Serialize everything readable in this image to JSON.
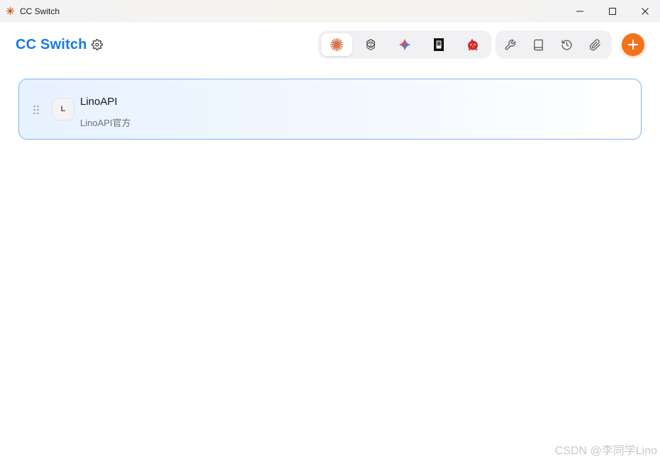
{
  "window": {
    "title": "CC Switch",
    "controls": [
      "minimize-icon",
      "maximize-icon",
      "close-icon"
    ]
  },
  "header": {
    "brand": "CC Switch",
    "settings_icon": "gear-icon",
    "app_switcher": [
      {
        "icon": "claude-icon",
        "active": true
      },
      {
        "icon": "openai-icon",
        "active": false
      },
      {
        "icon": "gemini-icon",
        "active": false
      },
      {
        "icon": "opencode-icon",
        "active": false
      },
      {
        "icon": "red-bird-icon",
        "active": false
      }
    ],
    "tools": [
      {
        "icon": "wrench-icon"
      },
      {
        "icon": "book-icon"
      },
      {
        "icon": "history-icon"
      },
      {
        "icon": "paperclip-icon"
      }
    ],
    "add_icon": "plus-icon",
    "accent_color": "#1877e6",
    "add_color": "#f47019"
  },
  "providers": [
    {
      "avatar_letter": "L",
      "name": "LinoAPI",
      "description": "LinoAPI官方",
      "active": true
    }
  ],
  "watermark": "CSDN @李同学Lino"
}
